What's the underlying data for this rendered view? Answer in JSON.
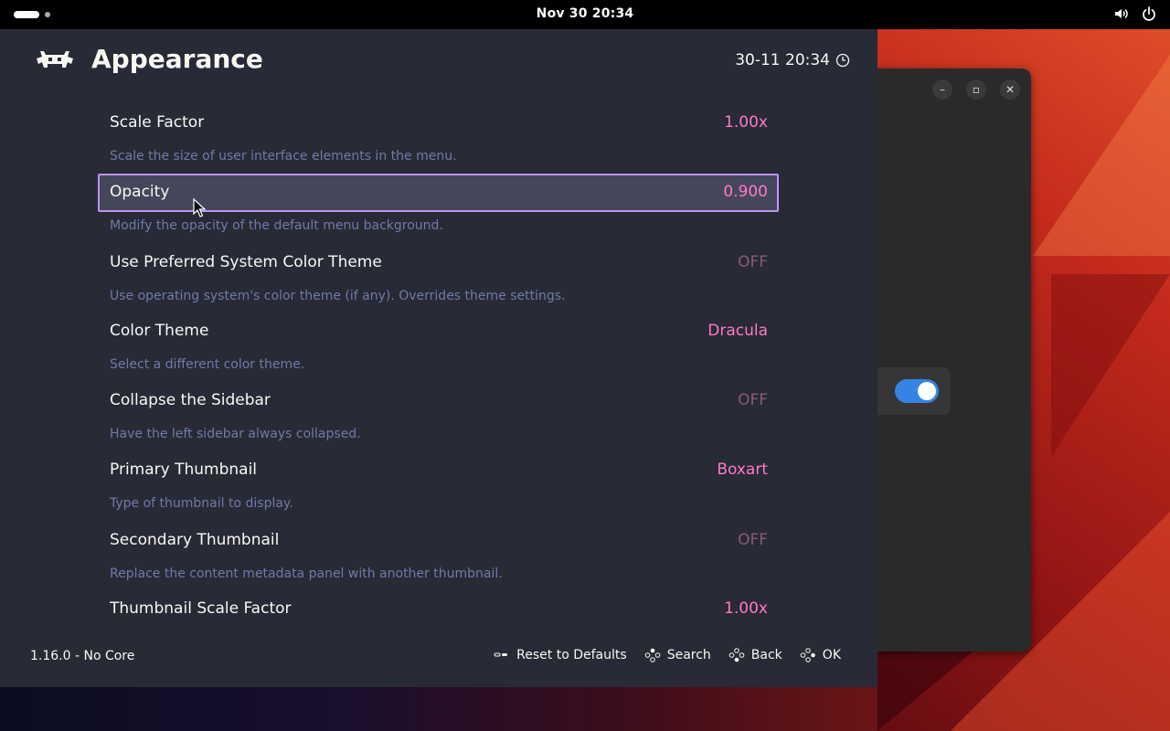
{
  "topbar": {
    "clock": "Nov 30  20:34",
    "icons": [
      "volume-icon",
      "power-icon"
    ]
  },
  "retroarch": {
    "title": "Appearance",
    "datetime": "30-11 20:34",
    "version": "1.16.0 - No Core",
    "accent_color": "#bd93f9",
    "value_color": "#ff79c6",
    "entries": [
      {
        "label": "Scale Factor",
        "value": "1.00x",
        "desc": "Scale the size of user interface elements in the menu."
      },
      {
        "label": "Opacity",
        "value": "0.900",
        "desc": "Modify the opacity of the default menu background."
      },
      {
        "label": "Use Preferred System Color Theme",
        "value": "OFF",
        "desc": "Use operating system's color theme (if any). Overrides theme settings."
      },
      {
        "label": "Color Theme",
        "value": "Dracula",
        "desc": "Select a different color theme."
      },
      {
        "label": "Collapse the Sidebar",
        "value": "OFF",
        "desc": "Have the left sidebar always collapsed."
      },
      {
        "label": "Primary Thumbnail",
        "value": "Boxart",
        "desc": "Type of thumbnail to display."
      },
      {
        "label": "Secondary Thumbnail",
        "value": "OFF",
        "desc": "Replace the content metadata panel with another thumbnail."
      },
      {
        "label": "Thumbnail Scale Factor",
        "value": "1.00x",
        "desc": ""
      }
    ],
    "footer_actions": [
      {
        "label": "Reset to Defaults",
        "icon": "select-button-icon"
      },
      {
        "label": "Search",
        "icon": "gamepad-buttons-icon"
      },
      {
        "label": "Back",
        "icon": "gamepad-buttons-icon"
      },
      {
        "label": "OK",
        "icon": "gamepad-buttons-icon"
      }
    ]
  },
  "background_window": {
    "toggle_state": "on",
    "toggle_color": "#3584e4"
  }
}
